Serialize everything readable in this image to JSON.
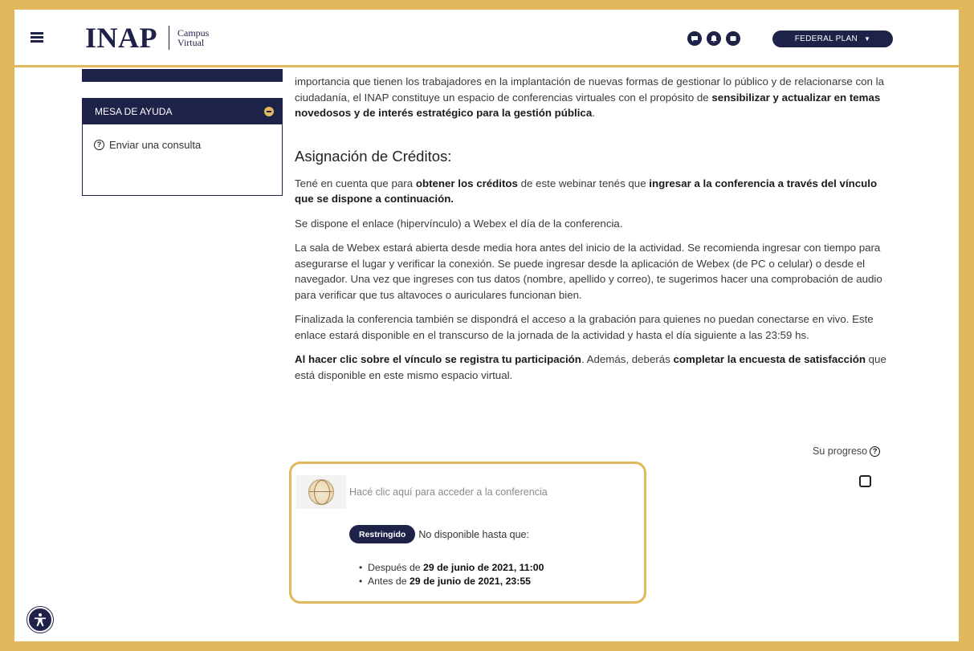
{
  "header": {
    "logo_main": "INAP",
    "logo_sub_line1": "Campus",
    "logo_sub_line2": "Virtual",
    "user_button": "FEDERAL PLAN",
    "icons": [
      "chat-icon",
      "bell-icon",
      "message-icon"
    ]
  },
  "sidebar": {
    "help_block_title": "MESA DE AYUDA",
    "help_link": "Enviar una consulta"
  },
  "main": {
    "intro_line1": "importancia que tienen los trabajadores en la implantación de nuevas formas de gestionar lo público y de",
    "intro_line2": "relacionarse con la ciudadanía, el INAP constituye un espacio de conferencias virtuales con el propósito de",
    "intro_bold": "sensibilizar y actualizar en temas novedosos y de interés estratégico para la gestión pública",
    "intro_end": ".",
    "section_title": "Asignación de Créditos:",
    "p1_a": "Tené en cuenta que para ",
    "p1_b": "obtener los créditos",
    "p1_c": " de este webinar tenés que ",
    "p1_d": "ingresar a la conferencia a través del vínculo que se dispone a continuación.",
    "p2": "Se dispone el enlace (hipervínculo) a Webex el día de la conferencia.",
    "p3": "La sala de Webex estará abierta desde media hora antes del inicio de la actividad. Se recomienda ingresar con tiempo para asegurarse el lugar y verificar la conexión. Se puede ingresar desde la aplicación de Webex (de PC o celular) o desde el navegador. Una vez que ingreses con tus datos (nombre, apellido y correo), te sugerimos hacer una comprobación de audio para verificar que tus altavoces o auriculares funcionan bien.",
    "p4": "Finalizada la conferencia también se dispondrá el acceso a la grabación para quienes no puedan conectarse en vivo. Este enlace estará disponible en el transcurso de la jornada de la actividad y hasta el día siguiente a las 23:59 hs.",
    "p5_a": "Al hacer clic sobre el vínculo se registra tu participación",
    "p5_b": ". Además, deberás ",
    "p5_c": "completar la encuesta de satisfacción",
    "p5_d": " que está disponible en este mismo espacio virtual.",
    "progress_label": "Su progreso"
  },
  "activity": {
    "link_text": "Hacé clic aquí para acceder a la conferencia",
    "badge": "Restringido",
    "restriction_text": "No disponible hasta que:",
    "conditions": [
      {
        "prefix": "Después de ",
        "date": "29 de junio de 2021, 11:00"
      },
      {
        "prefix": "Antes de ",
        "date": "29 de junio de 2021, 23:55"
      }
    ]
  },
  "colors": {
    "brand_navy": "#1e2148",
    "gold_frame": "#e1b85b"
  }
}
